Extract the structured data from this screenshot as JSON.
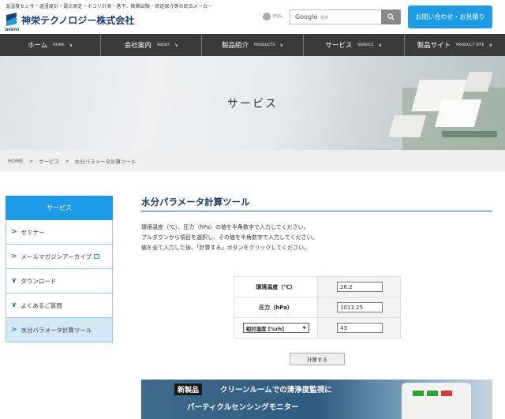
{
  "header": {
    "tagline": "温湿度センサ・温湿度計・露点測定・ホコリ計測・落下、衝撃試験・鉄道保守等の総合メーカー",
    "company": "神栄テクノロジー株式会社",
    "logo_sub": "SHINYEI",
    "lang": "ENG",
    "search_label": "Google",
    "search_sub": "提供",
    "contact": "お問い合わせ・お見積り"
  },
  "nav": [
    {
      "label": "ホーム",
      "en": "HOME"
    },
    {
      "label": "会社案内",
      "en": "ABOUT"
    },
    {
      "label": "製品紹介",
      "en": "PRODUCTS"
    },
    {
      "label": "サービス",
      "en": "SERVICE"
    },
    {
      "label": "製品サイト",
      "en": "PRODUCT SITE"
    }
  ],
  "hero": {
    "title": "サービス"
  },
  "breadcrumb": [
    "HOME",
    ">",
    "サービス",
    ">",
    "水分パラメータ計算ツール"
  ],
  "sidebar": {
    "header": "サービス",
    "items": [
      "セミナー",
      "メールマガジンアーカイブ",
      "ダウンロード",
      "よくあるご質問",
      "水分パラメータ計算ツール"
    ]
  },
  "main": {
    "title": "水分パラメータ計算ツール",
    "desc": [
      "環境温度（℃）、圧力（hPa）の値を半角数字で入力してください。",
      "プルダウンから項目を選択し、その値を半角数字で入力してください。",
      "値を全て入力した後、「計算する」ボタンをクリックしてください。"
    ],
    "rows": [
      {
        "label": "環境温度（℃）",
        "value": "26.2"
      },
      {
        "label": "圧力（hPa）",
        "value": "1013.25"
      },
      {
        "select": "相対湿度 [%rh]",
        "value": "43"
      }
    ],
    "button": "計算する"
  },
  "banner": {
    "tag": "新製品",
    "line1": "クリーンルームでの清浄度監視に",
    "line2": "パーティクルセンシングモニター"
  },
  "colors": {
    "accent": "#1d9be6",
    "nav": "#3a3a3a",
    "title": "#1a3d6e"
  }
}
